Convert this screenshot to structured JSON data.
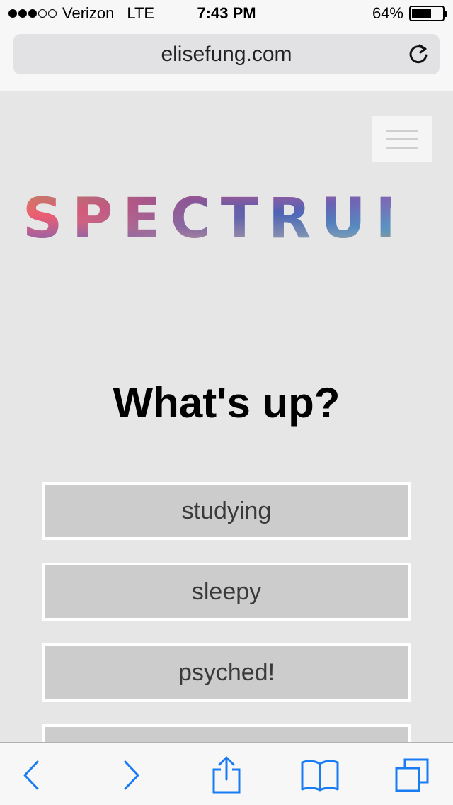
{
  "status_bar": {
    "carrier": "Verizon",
    "network": "LTE",
    "time": "7:43 PM",
    "battery_percent": "64%",
    "battery_level": 0.64,
    "signal_bars_filled": 3,
    "signal_bars_total": 5
  },
  "browser": {
    "url": "elisefung.com",
    "reload_icon": "reload-icon"
  },
  "page": {
    "logo_text": "SPECTRUM",
    "menu_icon": "hamburger-menu-icon",
    "heading": "What's up?",
    "moods": [
      {
        "label": "studying"
      },
      {
        "label": "sleepy"
      },
      {
        "label": "psyched!"
      },
      {
        "label": ""
      }
    ]
  },
  "toolbar": {
    "icons": [
      "back-icon",
      "forward-icon",
      "share-icon",
      "bookmarks-icon",
      "tabs-icon"
    ],
    "accent_color": "#1a7cf5"
  },
  "colors": {
    "page_background": "#e6e6e6",
    "button_background": "#cccccc",
    "button_border": "#ffffff"
  }
}
